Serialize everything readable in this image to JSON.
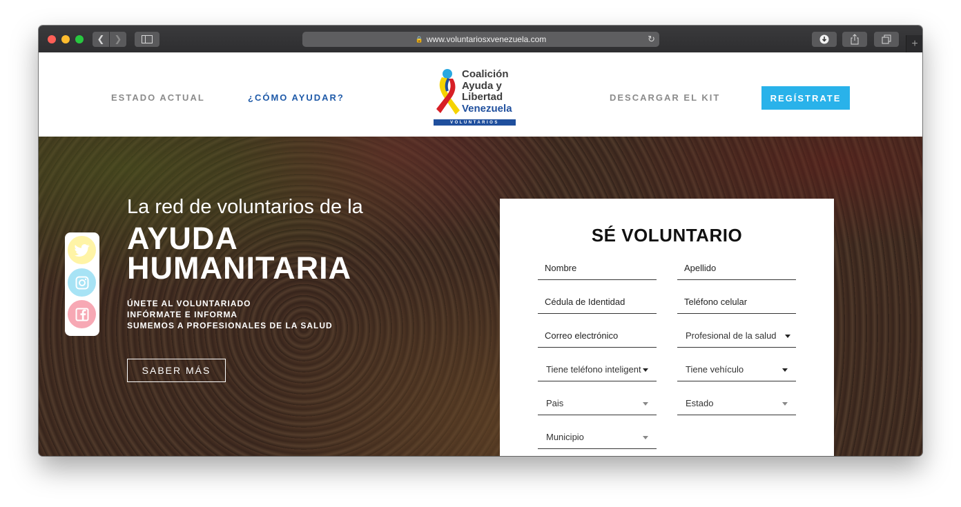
{
  "browser": {
    "url": "www.voluntariosxvenezuela.com"
  },
  "header": {
    "nav": {
      "estado": "ESTADO ACTUAL",
      "como": "¿CÓMO AYUDAR?",
      "kit": "DESCARGAR EL KIT",
      "register": "REGÍSTRATE"
    },
    "logo": {
      "line1": "Coalición",
      "line2": "Ayuda y",
      "line3": "Libertad",
      "line4": "Venezuela",
      "band": "VOLUNTARIOS"
    }
  },
  "hero": {
    "subtitle": "La red de voluntarios de la",
    "title_line1": "AYUDA",
    "title_line2": "HUMANITARIA",
    "bullets": [
      "ÚNETE AL VOLUNTARIADO",
      "INFÓRMATE E INFORMA",
      "SUMEMOS A PROFESIONALES DE LA SALUD"
    ],
    "cta": "SABER MÁS"
  },
  "social": [
    "twitter-icon",
    "instagram-icon",
    "facebook-icon"
  ],
  "form": {
    "title": "SÉ VOLUNTARIO",
    "fields": {
      "nombre": "Nombre",
      "apellido": "Apellido",
      "cedula": "Cédula de Identidad",
      "telefono": "Teléfono celular",
      "correo": "Correo electrónico",
      "profesional": "Profesional de la salud",
      "smartphone": "Tiene teléfono inteligente",
      "vehiculo": "Tiene vehículo",
      "pais": "Pais",
      "estado": "Estado",
      "municipio": "Municipio"
    }
  },
  "colors": {
    "accent": "#29b2ea",
    "link": "#1f5aa8"
  }
}
